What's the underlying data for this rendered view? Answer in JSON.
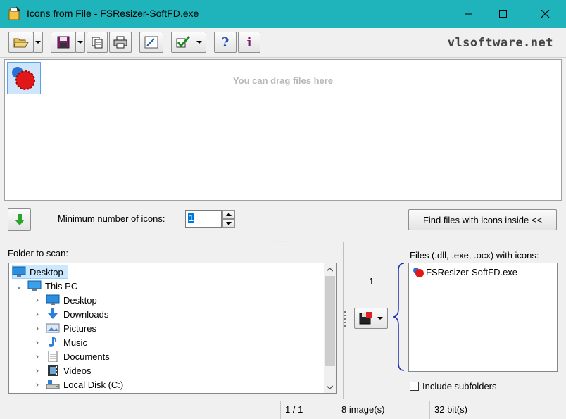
{
  "window": {
    "title": "Icons from File - FSResizer-SoftFD.exe",
    "titlebar_color": "#1fb4bc"
  },
  "toolbar": {
    "buttons": [
      {
        "icon": "folder-open-icon",
        "has_dropdown": true
      },
      {
        "icon": "save-disk-icon",
        "has_dropdown": true
      },
      {
        "icon": "copy-icon",
        "has_dropdown": false
      },
      {
        "icon": "print-icon",
        "has_dropdown": false
      },
      {
        "icon": "image-edit-icon",
        "has_dropdown": false
      },
      {
        "icon": "checkmark-icon",
        "has_dropdown": true
      },
      {
        "icon": "help-icon",
        "has_dropdown": false
      },
      {
        "icon": "info-icon",
        "has_dropdown": false
      }
    ],
    "help_glyph": "?",
    "info_glyph": "i",
    "brand": "vlsoftware.net"
  },
  "icons_pane": {
    "drag_hint": "You can drag files here"
  },
  "controls": {
    "min_icons_label": "Minimum number of icons:",
    "min_icons_value": "1",
    "find_button_label": "Find files with icons inside <<",
    "splitter_glyph": "......"
  },
  "folder_panel": {
    "label": "Folder to scan:",
    "tree": [
      {
        "label": "Desktop",
        "icon": "desktop-icon",
        "indent": 0,
        "chevron": "",
        "selected": true
      },
      {
        "label": "This PC",
        "icon": "computer-icon",
        "indent": 1,
        "chevron": "⌄",
        "selected": false
      },
      {
        "label": "Desktop",
        "icon": "desktop-icon",
        "indent": 2,
        "chevron": "›",
        "selected": false
      },
      {
        "label": "Downloads",
        "icon": "download-arrow-icon",
        "indent": 2,
        "chevron": "›",
        "selected": false
      },
      {
        "label": "Pictures",
        "icon": "pictures-icon",
        "indent": 2,
        "chevron": "›",
        "selected": false
      },
      {
        "label": "Music",
        "icon": "music-note-icon",
        "indent": 2,
        "chevron": "›",
        "selected": false
      },
      {
        "label": "Documents",
        "icon": "document-icon",
        "indent": 2,
        "chevron": "›",
        "selected": false
      },
      {
        "label": "Videos",
        "icon": "film-icon",
        "indent": 2,
        "chevron": "›",
        "selected": false
      },
      {
        "label": "Local Disk (C:)",
        "icon": "hard-disk-icon",
        "indent": 2,
        "chevron": "›",
        "selected": false
      }
    ]
  },
  "files_panel": {
    "count": "1",
    "label": "Files (.dll, .exe, .ocx) with icons:",
    "files": [
      "FSResizer-SoftFD.exe"
    ],
    "include_subfolders_label": "Include subfolders",
    "include_subfolders_checked": false
  },
  "status": {
    "page": "1 / 1",
    "images": "8 image(s)",
    "bits": "32 bit(s)"
  }
}
